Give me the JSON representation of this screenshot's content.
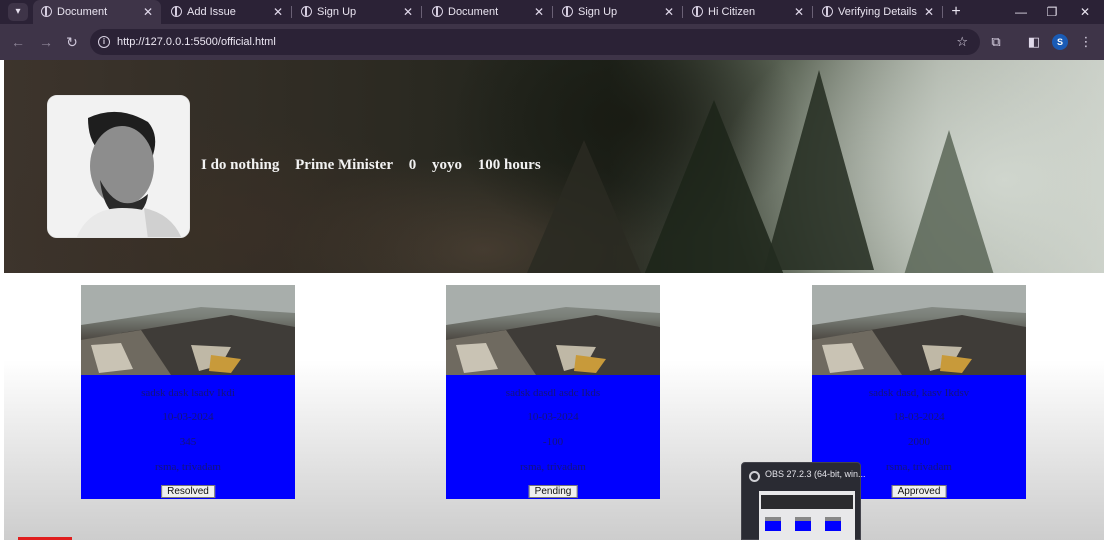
{
  "browser": {
    "tabs": [
      {
        "title": "Document",
        "active": true
      },
      {
        "title": "Add Issue",
        "active": false
      },
      {
        "title": "Sign Up",
        "active": false
      },
      {
        "title": "Document",
        "active": false
      },
      {
        "title": "Sign Up",
        "active": false
      },
      {
        "title": "Hi Citizen",
        "active": false
      },
      {
        "title": "Verifying Details",
        "active": false
      }
    ],
    "url": "http://127.0.0.1:5500/official.html",
    "profile_initial": "S",
    "colors": {
      "tabstrip": "#2b2236",
      "toolbar": "#3e3448",
      "omnibox": "#2b2236"
    }
  },
  "profile": {
    "bio": "I do nothing",
    "role": "Prime Minister",
    "count": "0",
    "name": "yoyo",
    "hours": "100 hours"
  },
  "issues": [
    {
      "title": "sadsk dask lsadv Ikdi",
      "date": "10-03-2024",
      "amount": "345",
      "location": "rsma, trivadam",
      "status": "Resolved"
    },
    {
      "title": "sadsk dasdl asdc Ikds",
      "date": "10-03-2024",
      "amount": "-100",
      "location": "rsma, trivadam",
      "status": "Pending"
    },
    {
      "title": "sadsk dasd, kasv Ikdsv",
      "date": "18-03-2024",
      "amount": "2000",
      "location": "rsma, trivadam",
      "status": "Approved"
    }
  ],
  "card_colors": {
    "body": "#0000ff",
    "text": "#14147a"
  },
  "obs_popup": {
    "title": "OBS 27.2.3 (64-bit, win..."
  }
}
